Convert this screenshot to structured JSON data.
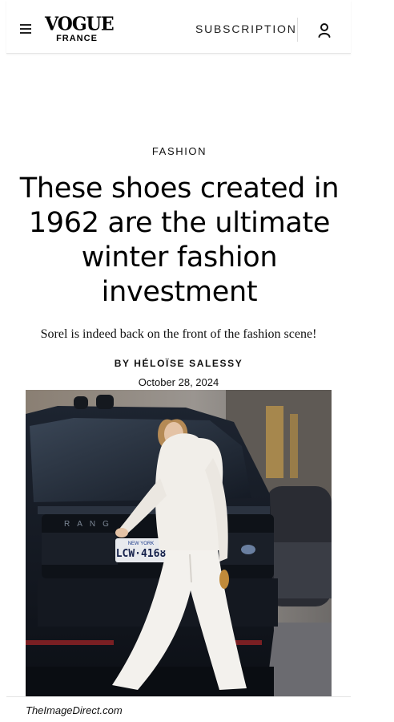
{
  "header": {
    "logo_main": "VOGUE",
    "logo_sub": "FRANCE",
    "subscribe_label": "SUBSCRIPTION"
  },
  "article": {
    "category": "FASHION",
    "headline": "These shoes created in 1962 are the ultimate winter fashion investment",
    "dek": "Sorel is indeed back on the front of the fashion scene!",
    "byline": "BY HÉLOÏSE SALESSY",
    "date": "October 28, 2024"
  },
  "photo": {
    "plate_state": "NEW YORK",
    "plate_number": "LCW·4168",
    "badge": "RANG",
    "credit": "TheImageDirect.com"
  },
  "icons": [
    "hamburger-menu-icon",
    "account-icon"
  ]
}
